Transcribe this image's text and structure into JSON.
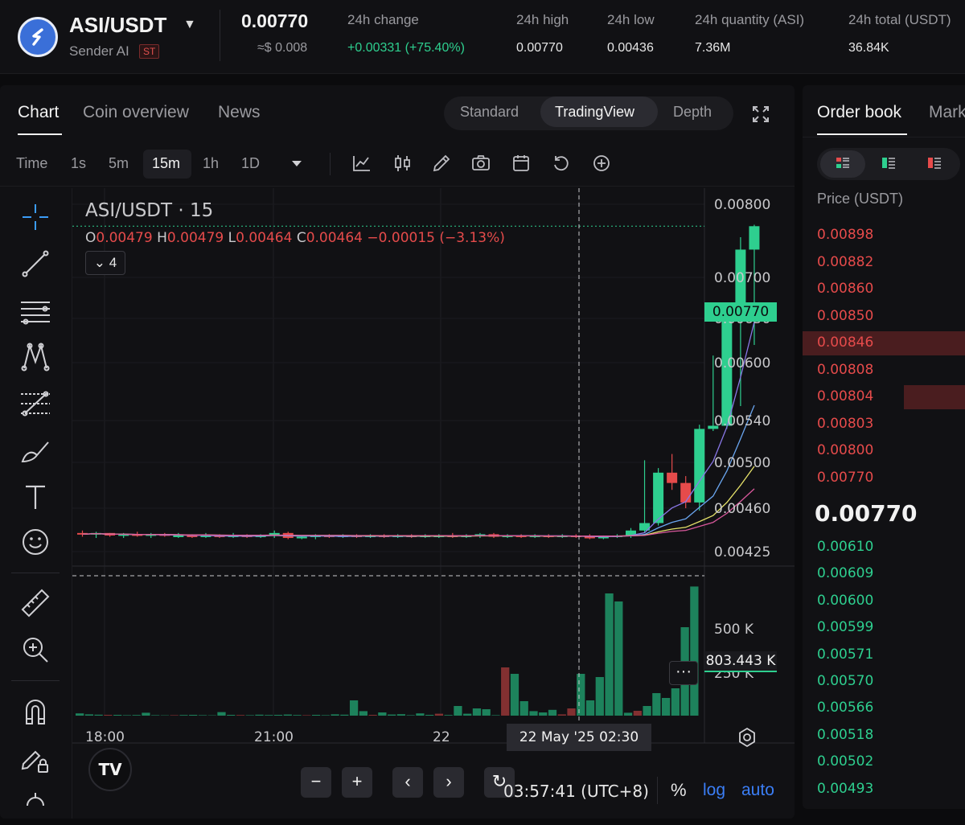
{
  "header": {
    "pair": "ASI/USDT",
    "name": "Sender AI",
    "badge": "ST",
    "last_price": "0.00770",
    "usd_price": "≈$ 0.008",
    "stats": [
      {
        "label": "24h change",
        "value": "+0.00331 (+75.40%)"
      },
      {
        "label": "24h high",
        "value": "0.00770"
      },
      {
        "label": "24h low",
        "value": "0.00436"
      },
      {
        "label": "24h quantity (ASI)",
        "value": "7.36M"
      },
      {
        "label": "24h total (USDT)",
        "value": "36.84K"
      }
    ]
  },
  "chart_tabs": [
    "Chart",
    "Coin overview",
    "News"
  ],
  "view_modes": [
    "Standard",
    "TradingView",
    "Depth"
  ],
  "toolbar": {
    "time_label": "Time",
    "intervals": [
      "1s",
      "5m",
      "15m",
      "1h",
      "1D"
    ],
    "active_interval": "15m"
  },
  "legend": {
    "title": "ASI/USDT · 15",
    "o_key": "O",
    "o_val": "0.00479",
    "h_key": "H",
    "h_val": "0.00479",
    "l_key": "L",
    "l_val": "0.00464",
    "c_key": "C",
    "c_val": "0.00464",
    "change": "−0.00015 (−3.13%)",
    "indicator_count": "4"
  },
  "price_axis_labels": [
    "0.00800",
    "0.00700",
    "0.00650",
    "0.00600",
    "0.00540",
    "0.00500",
    "0.00460",
    "0.00425"
  ],
  "last_price_tag": "0.00770",
  "volume_axis_labels": [
    "500 K",
    "250 K"
  ],
  "volume_tag": "803.443 K",
  "time_axis_labels": [
    "18:00",
    "21:00",
    "22"
  ],
  "crosshair_date": "22 May '25   02:30",
  "footer": {
    "clock": "03:57:41 (UTC+8)",
    "percent": "%",
    "log": "log",
    "auto": "auto"
  },
  "nav_buttons": [
    "−",
    "+",
    "‹",
    "›",
    "↻"
  ],
  "tv_logo": "TV",
  "more_dots": "···",
  "order_book": {
    "tabs": [
      "Order book",
      "Mark"
    ],
    "price_header": "Price (USDT)",
    "asks": [
      "0.00898",
      "0.00882",
      "0.00860",
      "0.00850",
      "0.00846",
      "0.00808",
      "0.00804",
      "0.00803",
      "0.00800",
      "0.00770"
    ],
    "mid_price": "0.00770",
    "bids": [
      "0.00610",
      "0.00609",
      "0.00600",
      "0.00599",
      "0.00571",
      "0.00570",
      "0.00566",
      "0.00518",
      "0.00502",
      "0.00493"
    ]
  },
  "colors": {
    "up": "#2ecf8f",
    "down": "#e64b4b",
    "accent_blue": "#3b7ef6"
  },
  "chart_data": {
    "type": "candlestick",
    "title": "ASI/USDT · 15",
    "interval": "15m",
    "x_tick_labels": [
      "18:00",
      "21:00",
      "22"
    ],
    "ylim": [
      0.0041,
      0.0081
    ],
    "y_ticks": [
      0.00425,
      0.0046,
      0.005,
      0.0054,
      0.006,
      0.0065,
      0.007,
      0.008
    ],
    "candles": [
      {
        "o": 0.0044,
        "h": 0.00442,
        "l": 0.00437,
        "c": 0.00439
      },
      {
        "o": 0.00439,
        "h": 0.00441,
        "l": 0.00436,
        "c": 0.0044
      },
      {
        "o": 0.0044,
        "h": 0.0044,
        "l": 0.00437,
        "c": 0.00438
      },
      {
        "o": 0.00438,
        "h": 0.0044,
        "l": 0.00436,
        "c": 0.00439
      },
      {
        "o": 0.00439,
        "h": 0.00441,
        "l": 0.00437,
        "c": 0.00438
      },
      {
        "o": 0.00438,
        "h": 0.0044,
        "l": 0.00436,
        "c": 0.00439
      },
      {
        "o": 0.00439,
        "h": 0.0044,
        "l": 0.00437,
        "c": 0.00438
      },
      {
        "o": 0.00438,
        "h": 0.0044,
        "l": 0.00436,
        "c": 0.00438
      },
      {
        "o": 0.00438,
        "h": 0.00439,
        "l": 0.00436,
        "c": 0.00437
      },
      {
        "o": 0.00437,
        "h": 0.0044,
        "l": 0.00436,
        "c": 0.00438
      },
      {
        "o": 0.00438,
        "h": 0.00439,
        "l": 0.00436,
        "c": 0.00437
      },
      {
        "o": 0.00437,
        "h": 0.0044,
        "l": 0.00436,
        "c": 0.00438
      },
      {
        "o": 0.00438,
        "h": 0.00439,
        "l": 0.00436,
        "c": 0.00437
      },
      {
        "o": 0.00437,
        "h": 0.00439,
        "l": 0.00436,
        "c": 0.00438
      },
      {
        "o": 0.00438,
        "h": 0.00442,
        "l": 0.00436,
        "c": 0.0044
      },
      {
        "o": 0.0044,
        "h": 0.00441,
        "l": 0.00435,
        "c": 0.00436
      },
      {
        "o": 0.00436,
        "h": 0.00438,
        "l": 0.00435,
        "c": 0.00437
      },
      {
        "o": 0.00437,
        "h": 0.00439,
        "l": 0.00435,
        "c": 0.00438
      },
      {
        "o": 0.00438,
        "h": 0.00439,
        "l": 0.00436,
        "c": 0.00437
      },
      {
        "o": 0.00437,
        "h": 0.00439,
        "l": 0.00436,
        "c": 0.00438
      },
      {
        "o": 0.00438,
        "h": 0.00439,
        "l": 0.00436,
        "c": 0.00437
      },
      {
        "o": 0.00437,
        "h": 0.00439,
        "l": 0.00436,
        "c": 0.00438
      },
      {
        "o": 0.00438,
        "h": 0.00439,
        "l": 0.00436,
        "c": 0.00437
      },
      {
        "o": 0.00437,
        "h": 0.00439,
        "l": 0.00436,
        "c": 0.00438
      },
      {
        "o": 0.00438,
        "h": 0.00439,
        "l": 0.00436,
        "c": 0.00437
      },
      {
        "o": 0.00437,
        "h": 0.00439,
        "l": 0.00436,
        "c": 0.00438
      },
      {
        "o": 0.00438,
        "h": 0.00439,
        "l": 0.00436,
        "c": 0.00438
      },
      {
        "o": 0.00438,
        "h": 0.0044,
        "l": 0.00436,
        "c": 0.00437
      },
      {
        "o": 0.00437,
        "h": 0.00439,
        "l": 0.00436,
        "c": 0.00438
      },
      {
        "o": 0.00438,
        "h": 0.0044,
        "l": 0.00436,
        "c": 0.00439
      },
      {
        "o": 0.00439,
        "h": 0.0044,
        "l": 0.00436,
        "c": 0.00437
      },
      {
        "o": 0.00437,
        "h": 0.00439,
        "l": 0.00436,
        "c": 0.00438
      },
      {
        "o": 0.00438,
        "h": 0.00439,
        "l": 0.00436,
        "c": 0.00437
      },
      {
        "o": 0.00437,
        "h": 0.00439,
        "l": 0.00436,
        "c": 0.00438
      },
      {
        "o": 0.00438,
        "h": 0.00439,
        "l": 0.00436,
        "c": 0.00437
      },
      {
        "o": 0.00437,
        "h": 0.00439,
        "l": 0.00436,
        "c": 0.00438
      },
      {
        "o": 0.00438,
        "h": 0.00439,
        "l": 0.00436,
        "c": 0.00437
      },
      {
        "o": 0.00437,
        "h": 0.00439,
        "l": 0.00435,
        "c": 0.00436
      },
      {
        "o": 0.00436,
        "h": 0.00438,
        "l": 0.00435,
        "c": 0.00437
      },
      {
        "o": 0.00437,
        "h": 0.00439,
        "l": 0.00436,
        "c": 0.00438
      },
      {
        "o": 0.00438,
        "h": 0.00444,
        "l": 0.00436,
        "c": 0.00442
      },
      {
        "o": 0.00442,
        "h": 0.00502,
        "l": 0.0044,
        "c": 0.00448
      },
      {
        "o": 0.00448,
        "h": 0.00495,
        "l": 0.00446,
        "c": 0.00491
      },
      {
        "o": 0.00491,
        "h": 0.00508,
        "l": 0.00476,
        "c": 0.00482
      },
      {
        "o": 0.00482,
        "h": 0.00488,
        "l": 0.0046,
        "c": 0.00465
      },
      {
        "o": 0.00465,
        "h": 0.00536,
        "l": 0.00458,
        "c": 0.00532
      },
      {
        "o": 0.00532,
        "h": 0.00608,
        "l": 0.0053,
        "c": 0.00535
      },
      {
        "o": 0.00535,
        "h": 0.00655,
        "l": 0.00532,
        "c": 0.00655
      },
      {
        "o": 0.00655,
        "h": 0.00755,
        "l": 0.00555,
        "c": 0.00738
      },
      {
        "o": 0.00738,
        "h": 0.00772,
        "l": 0.0062,
        "c": 0.0077
      }
    ],
    "volume": [
      14,
      8,
      6,
      5,
      5,
      3,
      4,
      18,
      3,
      2,
      3,
      4,
      5,
      3,
      2,
      22,
      5,
      4,
      3,
      6,
      4,
      5,
      7,
      4,
      3,
      5,
      3,
      8,
      6,
      95,
      28,
      5,
      20,
      7,
      9,
      3,
      14,
      5,
      12,
      4,
      60,
      12,
      45,
      40,
      3,
      300,
      260,
      90,
      28,
      20,
      36,
      8,
      45,
      260,
      95,
      240,
      760,
      710,
      18,
      30,
      60,
      140,
      110,
      170,
      550,
      803
    ],
    "volume_unit": "K"
  }
}
